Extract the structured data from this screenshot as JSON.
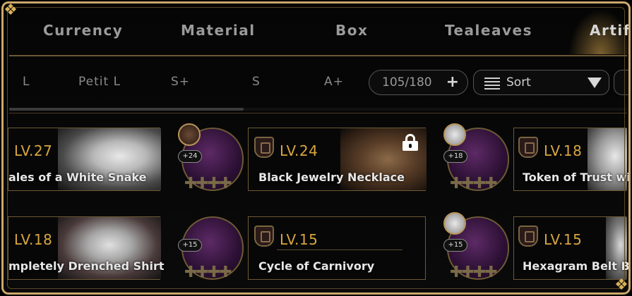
{
  "tabs": [
    {
      "label": "Currency"
    },
    {
      "label": "Material"
    },
    {
      "label": "Box"
    },
    {
      "label": "Tealeaves"
    },
    {
      "label": "Artif"
    }
  ],
  "filters": [
    {
      "label": "L"
    },
    {
      "label": "Petit L"
    },
    {
      "label": "S+"
    },
    {
      "label": "S"
    },
    {
      "label": "A+"
    }
  ],
  "inventory": {
    "count": "105/180",
    "expand_icon": "plus-icon"
  },
  "sort": {
    "label": "Sort",
    "icon": "list-icon",
    "dropdown_icon": "triangle-down-icon"
  },
  "scroll_fraction_visible": 0.38,
  "items": [
    {
      "level": "LV.27",
      "name": "ales of a White Snake",
      "enhance": ""
    },
    {
      "level": "LV.24",
      "name": "Black Jewelry Necklace",
      "enhance": "+24",
      "locked": true
    },
    {
      "level": "LV.18",
      "name": "Token of Trust wit",
      "enhance": "+18"
    },
    {
      "level": "LV.18",
      "name": "mpletely Drenched Shirt",
      "enhance": ""
    },
    {
      "level": "LV.15",
      "name": "Cycle of Carnivory",
      "enhance": "+15"
    },
    {
      "level": "LV.15",
      "name": "Hexagram Belt B",
      "enhance": "+15"
    }
  ],
  "colors": {
    "gold": "#d9a640",
    "border": "#caa86a"
  }
}
